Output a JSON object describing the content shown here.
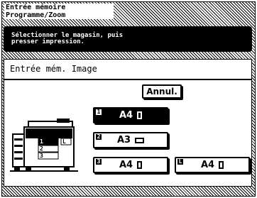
{
  "header": {
    "title_line1": "Entrée mémoire",
    "title_line2": "Programme/Zoom"
  },
  "message": "Sélectionner le magasin, puis\npresser impression.",
  "content": {
    "title": "Entrée mém. Image",
    "cancel_label": "Annul."
  },
  "trays": [
    {
      "number": "1",
      "size": "A4",
      "orientation": "portrait",
      "selected": true
    },
    {
      "number": "2",
      "size": "A3",
      "orientation": "landscape",
      "selected": false
    },
    {
      "number": "3",
      "size": "A4",
      "orientation": "portrait",
      "selected": false
    },
    {
      "number": "L",
      "size": "A4",
      "orientation": "portrait",
      "selected": false
    }
  ],
  "copier": {
    "drawer_labels": [
      "1",
      "2",
      "3",
      "L"
    ]
  }
}
